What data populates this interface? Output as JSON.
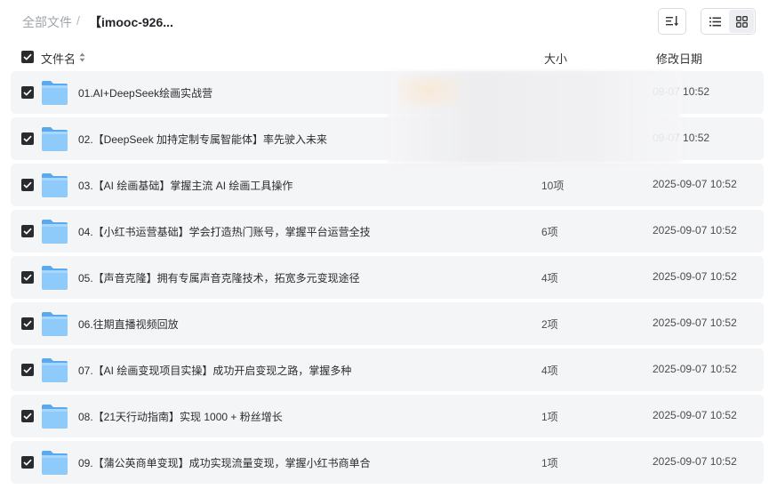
{
  "breadcrumb": {
    "root": "全部文件",
    "separator": "/",
    "current": "【imooc-926..."
  },
  "toolbar": {
    "sort_icon": "sort-lines-icon",
    "list_view_icon": "list-view-icon",
    "grid_view_icon": "grid-view-icon"
  },
  "table": {
    "headers": {
      "name": "文件名",
      "size": "大小",
      "modified": "修改日期"
    },
    "rows": [
      {
        "name": "01.AI+DeepSeek绘画实战营",
        "size": "",
        "date": "09-07 10:52"
      },
      {
        "name": "02.【DeepSeek 加持定制专属智能体】率先驶入未来",
        "size": "",
        "date": "09-07 10:52"
      },
      {
        "name": "03.【AI 绘画基础】掌握主流 AI 绘画工具操作",
        "size": "10项",
        "date": "2025-09-07 10:52"
      },
      {
        "name": "04.【小红书运营基础】学会打造热门账号，掌握平台运营全技",
        "size": "6项",
        "date": "2025-09-07 10:52"
      },
      {
        "name": "05.【声音克隆】拥有专属声音克隆技术，拓宽多元变现途径",
        "size": "4项",
        "date": "2025-09-07 10:52"
      },
      {
        "name": "06.往期直播视频回放",
        "size": "2项",
        "date": "2025-09-07 10:52"
      },
      {
        "name": "07.【AI 绘画变现项目实操】成功开启变现之路，掌握多种",
        "size": "4项",
        "date": "2025-09-07 10:52"
      },
      {
        "name": "08.【21天行动指南】实现 1000 + 粉丝增长",
        "size": "1项",
        "date": "2025-09-07 10:52"
      },
      {
        "name": "09.【蒲公英商单变现】成功实现流量变现，掌握小红书商单合",
        "size": "1项",
        "date": "2025-09-07 10:52"
      }
    ]
  },
  "colors": {
    "folder": "#7cc1f7",
    "row_bg": "#f4f5f7",
    "checkbox": "#2a2b2f"
  }
}
